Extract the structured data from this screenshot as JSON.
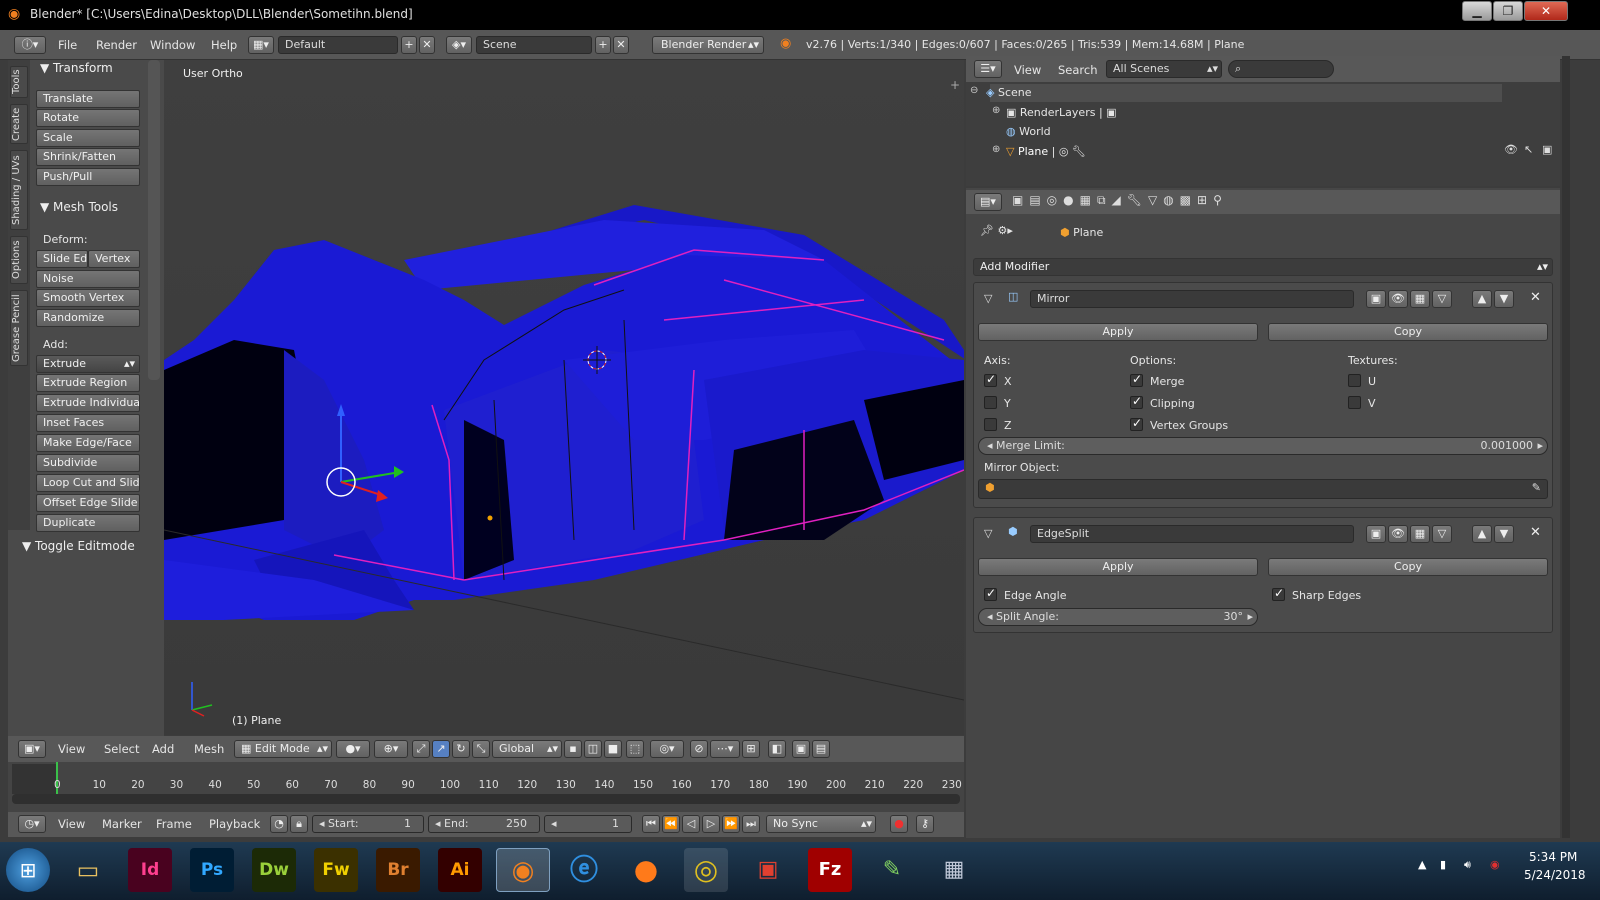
{
  "window": {
    "title": "Blender* [C:\\Users\\Edina\\Desktop\\DLL\\Blender\\Sometihn.blend]",
    "min": "▁",
    "max": "❐",
    "close": "✕"
  },
  "infobar": {
    "menus": [
      "File",
      "Render",
      "Window",
      "Help"
    ],
    "layout": "Default",
    "scene": "Scene",
    "engine": "Blender Render",
    "stats": "v2.76 | Verts:1/340 | Edges:0/607 | Faces:0/265 | Tris:539 | Mem:14.68M | Plane"
  },
  "tabs": [
    "Tools",
    "Create",
    "Shading / UVs",
    "Options",
    "Grease Pencil"
  ],
  "toolshelf": {
    "transform_title": "Transform",
    "transform": [
      "Translate",
      "Rotate",
      "Scale",
      "Shrink/Fatten",
      "Push/Pull"
    ],
    "mesh_title": "Mesh Tools",
    "deform_label": "Deform:",
    "slide_edge": "Slide Ed",
    "vertex": "Vertex",
    "deform": [
      "Noise",
      "Smooth Vertex",
      "Randomize"
    ],
    "add_label": "Add:",
    "extrude": "Extrude",
    "add": [
      "Extrude Region",
      "Extrude Individual",
      "Inset Faces",
      "Make Edge/Face",
      "Subdivide",
      "Loop Cut and Slide",
      "Offset Edge Slide",
      "Duplicate"
    ],
    "toggle": "Toggle Editmode"
  },
  "viewport": {
    "view_label": "User Ortho",
    "object_label": "(1) Plane"
  },
  "viewheader": {
    "menus": [
      "View",
      "Select",
      "Add",
      "Mesh"
    ],
    "mode": "Edit Mode",
    "orientation": "Global"
  },
  "timeline": {
    "ticks": [
      "0",
      "10",
      "20",
      "30",
      "40",
      "50",
      "60",
      "70",
      "80",
      "90",
      "100",
      "110",
      "120",
      "130",
      "140",
      "150",
      "160",
      "170",
      "180",
      "190",
      "200",
      "210",
      "220",
      "230"
    ],
    "menus": [
      "View",
      "Marker",
      "Frame",
      "Playback"
    ],
    "start_label": "Start:",
    "start": "1",
    "end_label": "End:",
    "end": "250",
    "current": "1",
    "sync": "No Sync"
  },
  "outliner": {
    "view": "View",
    "search": "Search",
    "filter": "All Scenes",
    "items": [
      "Scene",
      "RenderLayers",
      "World",
      "Plane"
    ]
  },
  "properties": {
    "context": "Plane",
    "add_modifier": "Add Modifier",
    "mirror": {
      "name": "Mirror",
      "apply": "Apply",
      "copy": "Copy",
      "axis_label": "Axis:",
      "options_label": "Options:",
      "textures_label": "Textures:",
      "x": "X",
      "y": "Y",
      "z": "Z",
      "merge": "Merge",
      "clipping": "Clipping",
      "vgroups": "Vertex Groups",
      "u": "U",
      "v": "V",
      "merge_limit_label": "Merge Limit:",
      "merge_limit": "0.001000",
      "mirror_object_label": "Mirror Object:"
    },
    "edgesplit": {
      "name": "EdgeSplit",
      "apply": "Apply",
      "copy": "Copy",
      "edge_angle": "Edge Angle",
      "sharp_edges": "Sharp Edges",
      "split_angle_label": "Split Angle:",
      "split_angle": "30°"
    }
  },
  "taskbar": {
    "apps": [
      "Id",
      "Ps",
      "Dw",
      "Fw",
      "Br",
      "Ai",
      "Fz"
    ],
    "time": "5:34 PM",
    "date": "5/24/2018"
  },
  "colors": {
    "blue_mesh": "#1a1ae0",
    "selection": "#e020c0",
    "accent": "#5680c2"
  }
}
